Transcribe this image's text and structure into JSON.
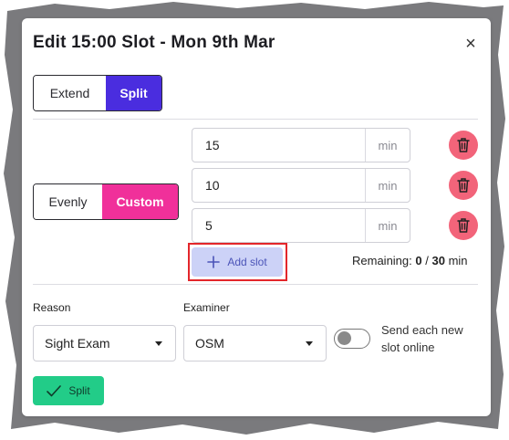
{
  "dialog": {
    "title": "Edit 15:00 Slot - Mon 9th Mar",
    "close_label": "×"
  },
  "mode_toggle": {
    "options": [
      "Extend",
      "Split"
    ],
    "selected": "Split"
  },
  "split_type_toggle": {
    "options": [
      "Evenly",
      "Custom"
    ],
    "selected": "Custom"
  },
  "slots": [
    {
      "value": "15",
      "unit": "min"
    },
    {
      "value": "10",
      "unit": "min"
    },
    {
      "value": "5",
      "unit": "min"
    }
  ],
  "add_slot": {
    "label": "Add slot"
  },
  "remaining": {
    "label": "Remaining:",
    "used": "0",
    "separator": "/",
    "total": "30",
    "unit": "min"
  },
  "reason": {
    "label": "Reason",
    "selected": "Sight Exam"
  },
  "examiner": {
    "label": "Examiner",
    "selected": "OSM"
  },
  "online_toggle": {
    "label": "Send each new slot online",
    "checked": false
  },
  "submit": {
    "label": "Split"
  },
  "colors": {
    "primary_purple": "#4a2ddf",
    "accent_pink": "#f0309a",
    "danger": "#f2647a",
    "success": "#22cc88",
    "highlight_outline": "#e3262b"
  }
}
